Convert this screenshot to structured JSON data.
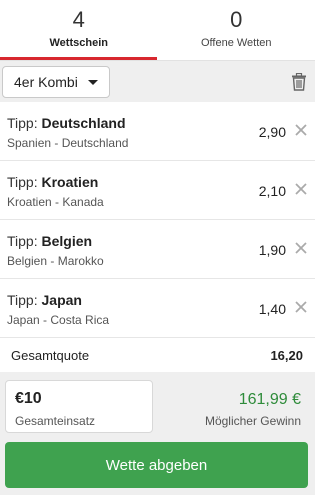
{
  "tabs": [
    {
      "count": "4",
      "label": "Wettschein"
    },
    {
      "count": "0",
      "label": "Offene Wetten"
    }
  ],
  "toolbar": {
    "combi_select": "4er Kombi",
    "trash_icon": "trash-icon"
  },
  "bets": [
    {
      "tip_prefix": "Tipp:",
      "team": "Deutschland",
      "match": "Spanien - Deutschland",
      "odds": "2,90"
    },
    {
      "tip_prefix": "Tipp:",
      "team": "Kroatien",
      "match": "Kroatien - Kanada",
      "odds": "2,10"
    },
    {
      "tip_prefix": "Tipp:",
      "team": "Belgien",
      "match": "Belgien - Marokko",
      "odds": "1,90"
    },
    {
      "tip_prefix": "Tipp:",
      "team": "Japan",
      "match": "Japan - Costa Rica",
      "odds": "1,40"
    }
  ],
  "total": {
    "label": "Gesamtquote",
    "value": "16,20"
  },
  "stake": {
    "amount": "€10",
    "label": "Gesamteinsatz"
  },
  "win": {
    "amount": "161,99 €",
    "label": "Möglicher Gewinn"
  },
  "submit_label": "Wette abgeben",
  "colors": {
    "accent_red": "#d8282f",
    "win_green": "#2e8b3a",
    "button_green": "#3fa24f"
  }
}
